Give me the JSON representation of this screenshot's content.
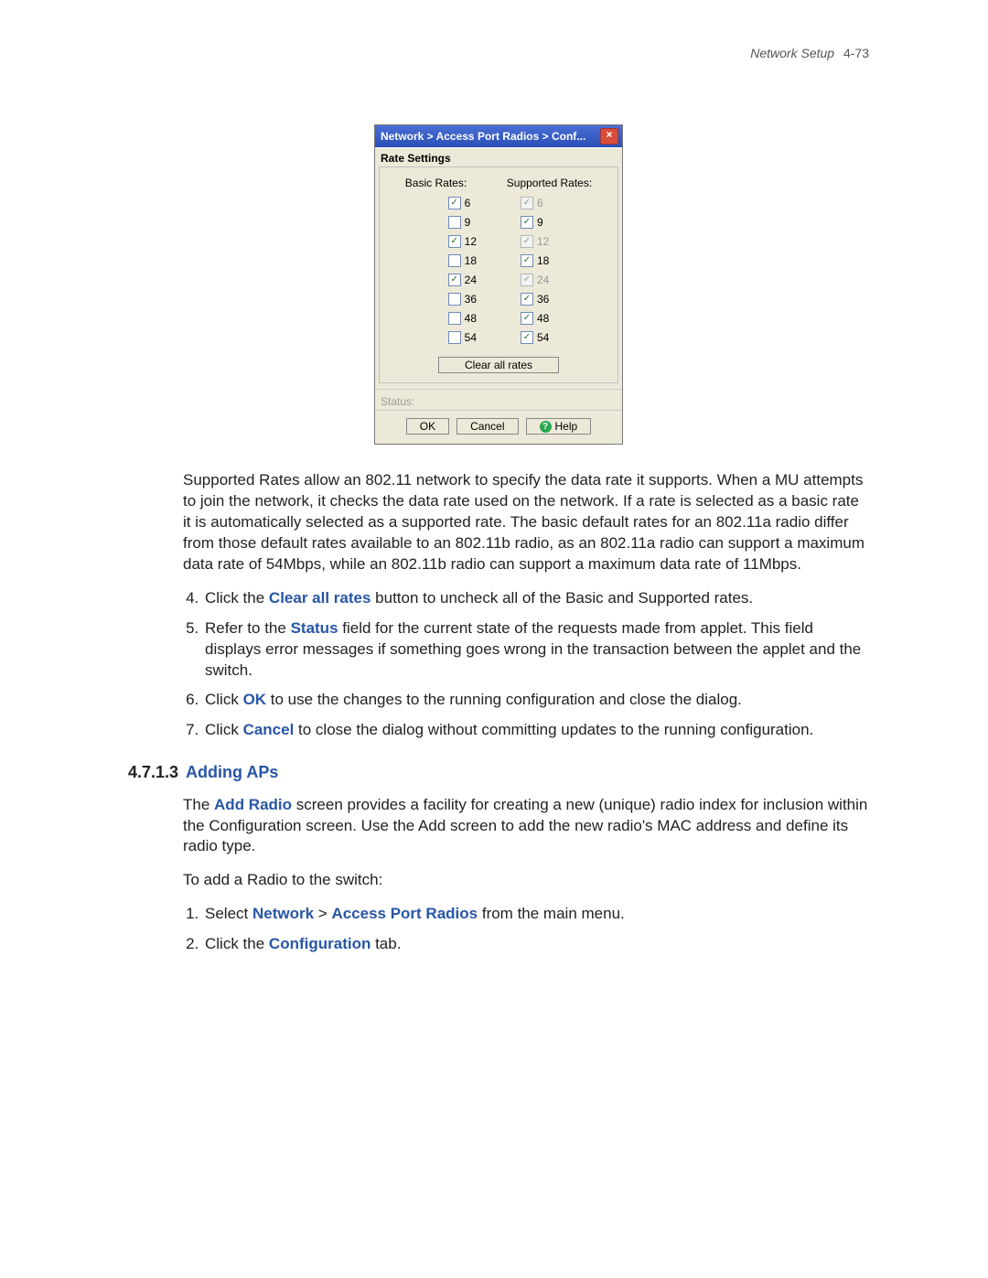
{
  "header": {
    "section": "Network Setup",
    "page": "4-73"
  },
  "dialog": {
    "title": "Network > Access Port Radios > Conf...",
    "panel_label": "Rate Settings",
    "basic_header": "Basic Rates:",
    "supported_header": "Supported Rates:",
    "rates": [
      {
        "label": "6",
        "basic_checked": true,
        "supported_checked": true,
        "supported_disabled": true
      },
      {
        "label": "9",
        "basic_checked": false,
        "supported_checked": true,
        "supported_disabled": false
      },
      {
        "label": "12",
        "basic_checked": true,
        "supported_checked": true,
        "supported_disabled": true
      },
      {
        "label": "18",
        "basic_checked": false,
        "supported_checked": true,
        "supported_disabled": false
      },
      {
        "label": "24",
        "basic_checked": true,
        "supported_checked": true,
        "supported_disabled": true
      },
      {
        "label": "36",
        "basic_checked": false,
        "supported_checked": true,
        "supported_disabled": false
      },
      {
        "label": "48",
        "basic_checked": false,
        "supported_checked": true,
        "supported_disabled": false
      },
      {
        "label": "54",
        "basic_checked": false,
        "supported_checked": true,
        "supported_disabled": false
      }
    ],
    "clear_label": "Clear all rates",
    "status_label": "Status:",
    "ok_label": "OK",
    "cancel_label": "Cancel",
    "help_label": "Help"
  },
  "body": {
    "supported_para": "Supported Rates allow an 802.11 network to specify the data rate it supports. When a MU attempts to join the network, it checks the data rate used on the network. If a rate is selected as a basic rate it is automatically selected as a supported rate. The basic default rates for an 802.11a radio differ from those default rates available to an 802.11b radio, as an 802.11a radio can support a maximum data rate of 54Mbps, while an 802.11b radio can support a maximum data rate of 11Mbps.",
    "step4_pre": "Click the ",
    "step4_bold": "Clear all rates",
    "step4_post": " button to uncheck all of the Basic and Supported rates.",
    "step5_pre": "Refer to the ",
    "step5_bold": "Status",
    "step5_post": " field for the current state of the requests made from applet. This field displays error messages if something goes wrong in the transaction between the applet and the switch.",
    "step6_pre": "Click ",
    "step6_bold": "OK",
    "step6_post": " to use the changes to the running configuration and close the dialog.",
    "step7_pre": "Click ",
    "step7_bold": "Cancel",
    "step7_post": " to close the dialog without committing updates to the running configuration.",
    "section_number": "4.7.1.3",
    "section_title": "Adding APs",
    "add_para_pre": "The ",
    "add_para_bold": "Add Radio",
    "add_para_post": " screen provides a facility for creating a new (unique) radio index for inclusion within the Configuration screen. Use the Add screen to add the new radio's MAC address and define its radio type.",
    "add_lead": "To add a Radio to the switch:",
    "add1_pre": "Select ",
    "add1_b1": "Network",
    "add1_mid": " > ",
    "add1_b2": "Access Port Radios",
    "add1_post": " from the main menu.",
    "add2_pre": "Click the ",
    "add2_bold": "Configuration",
    "add2_post": " tab."
  }
}
